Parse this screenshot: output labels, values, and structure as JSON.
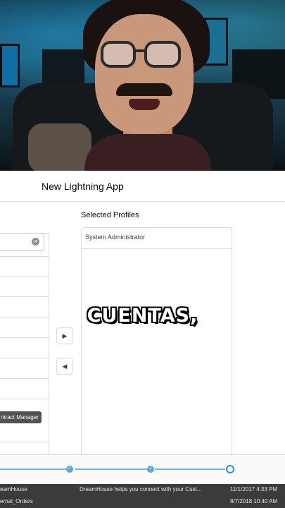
{
  "modal": {
    "title": "New Lightning App"
  },
  "profiles": {
    "selected_label": "Selected Profiles",
    "selected_items": [
      "System Administrator"
    ],
    "tooltip": "ntract Manager",
    "move_right_glyph": "▶",
    "move_left_glyph": "◀",
    "clear_glyph": "×"
  },
  "list": {
    "rows": [
      {
        "name": "eamHouse",
        "description": "DreamHouse helps you connect with your Cust...",
        "date": "11/1/2017 4:33 PM"
      },
      {
        "name": "ernal_Orders",
        "description": "",
        "date": "8/7/2018 10:40 AM"
      }
    ]
  },
  "caption": {
    "text": "CUENTAS,"
  },
  "progress": {
    "completed_glyph": "✓",
    "steps_completed": 2,
    "steps_total": 3
  },
  "colors": {
    "brand_blue": "#1b96ff",
    "progress_blue": "#5ba4e0"
  }
}
